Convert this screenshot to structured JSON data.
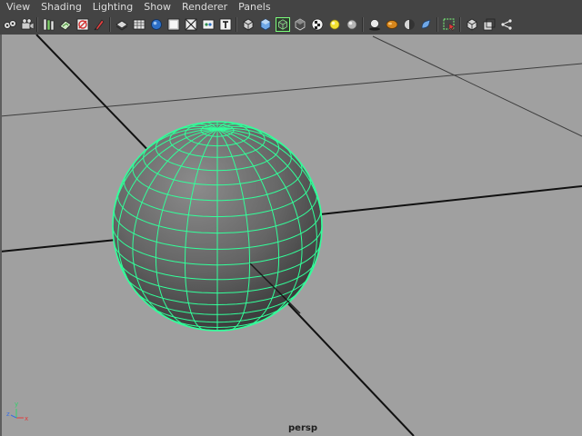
{
  "menubar": {
    "items": [
      {
        "label": "View"
      },
      {
        "label": "Shading"
      },
      {
        "label": "Lighting"
      },
      {
        "label": "Show"
      },
      {
        "label": "Renderer"
      },
      {
        "label": "Panels"
      }
    ]
  },
  "toolbar": {
    "buttons": [
      {
        "icon": "select-camera-icon"
      },
      {
        "icon": "camera-attributes-icon"
      },
      {
        "icon": "bookmarks-icon"
      },
      {
        "icon": "image-plane-icon"
      },
      {
        "icon": "grid-toggle-icon"
      },
      {
        "icon": "film-gate-icon"
      },
      {
        "icon": "wireframe-icon"
      },
      {
        "icon": "smooth-shade-icon"
      },
      {
        "icon": "flat-shade-icon"
      },
      {
        "icon": "bounding-box-icon"
      },
      {
        "icon": "textured-icon"
      },
      {
        "icon": "text-icon"
      },
      {
        "icon": "cube-outline-icon"
      },
      {
        "icon": "cube-shaded-icon"
      },
      {
        "icon": "wireframe-on-shaded-icon"
      },
      {
        "icon": "xray-icon"
      },
      {
        "icon": "checker-icon"
      },
      {
        "icon": "default-light-icon"
      },
      {
        "icon": "all-lights-icon"
      },
      {
        "icon": "shadows-icon"
      },
      {
        "icon": "screen-ao-icon"
      },
      {
        "icon": "motion-blur-icon"
      },
      {
        "icon": "anti-alias-icon"
      },
      {
        "icon": "isolate-select-icon"
      },
      {
        "icon": "xray-joints-icon"
      },
      {
        "icon": "single-pane-icon"
      },
      {
        "icon": "two-pane-icon"
      },
      {
        "icon": "share-icon"
      }
    ]
  },
  "viewport": {
    "camera_label": "persp",
    "background_color": "#a0a0a0",
    "wire_color": "#32ff9a",
    "axis": {
      "x_label": "x",
      "y_label": "y",
      "z_label": "z"
    }
  }
}
